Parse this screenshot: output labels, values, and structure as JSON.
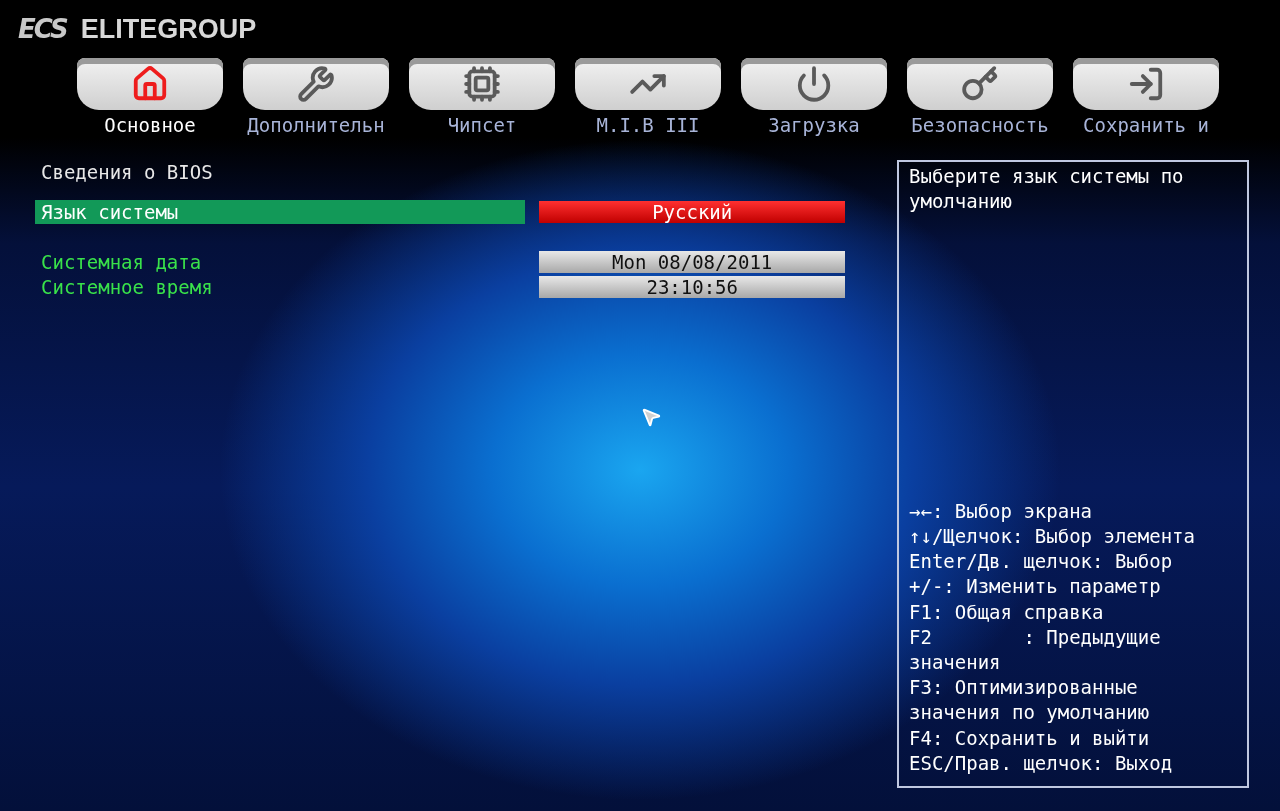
{
  "brand": {
    "mark": "ECS",
    "name": "ELITEGROUP"
  },
  "tabs": [
    {
      "label": "Основное",
      "kind": "home",
      "selected": true
    },
    {
      "label": "Дополнительн",
      "kind": "wrench",
      "selected": false
    },
    {
      "label": "Чипсет",
      "kind": "chip",
      "selected": false
    },
    {
      "label": "M.I.B III",
      "kind": "chart",
      "selected": false
    },
    {
      "label": "Загрузка",
      "kind": "power",
      "selected": false
    },
    {
      "label": "Безопасность",
      "kind": "key",
      "selected": false
    },
    {
      "label": "Сохранить и",
      "kind": "exit",
      "selected": false
    }
  ],
  "settings": [
    {
      "kind": "header",
      "label": "Сведения о BIOS"
    },
    {
      "kind": "option",
      "label": "Язык системы",
      "value": "Русский",
      "selected": true
    },
    {
      "kind": "gap"
    },
    {
      "kind": "option",
      "label": "Системная дата",
      "value": "Mon 08/08/2011",
      "selected": false
    },
    {
      "kind": "option",
      "label": "Системное время",
      "value": "23:10:56",
      "selected": false
    }
  ],
  "help": {
    "description": "Выберите язык системы по умолчанию",
    "keys": [
      "→←: Выбор экрана",
      "↑↓/Щелчок: Выбор элемента",
      "Enter/Дв. щелчок: Выбор",
      "+/-: Изменить параметр",
      "F1: Общая справка",
      "F2        : Предыдущие",
      "значения",
      "F3: Оптимизированные",
      "значения по умолчанию",
      "F4: Сохранить и выйти",
      "ESC/Прав. щелчок: Выход"
    ]
  }
}
